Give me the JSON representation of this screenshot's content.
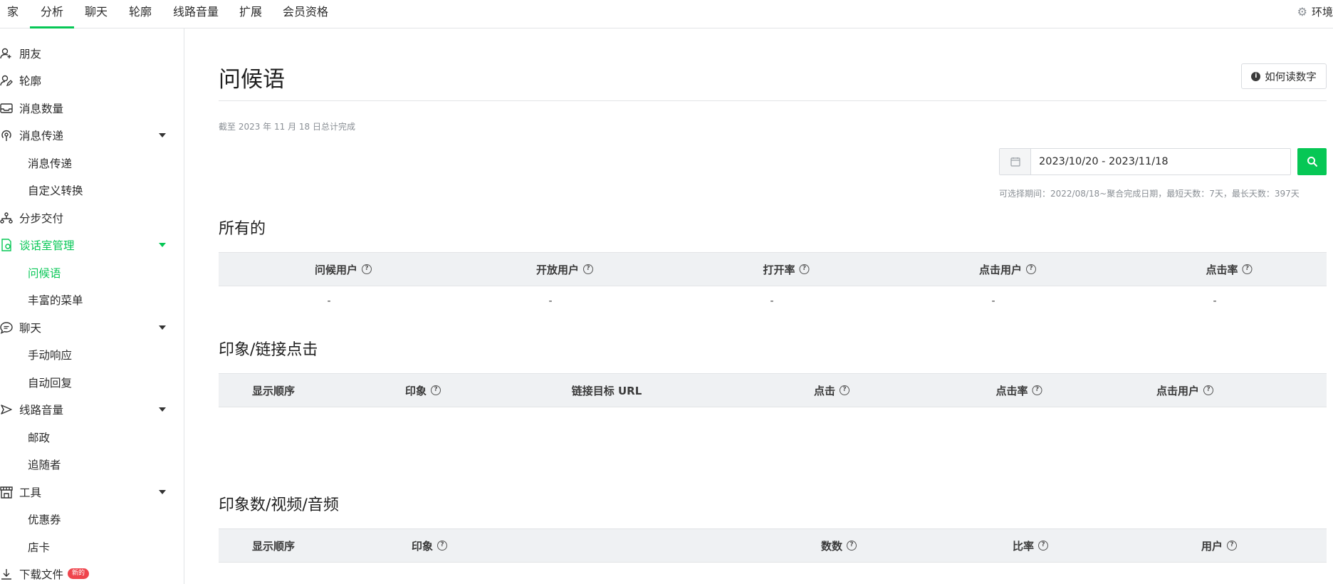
{
  "topnav": {
    "tabs": [
      "家",
      "分析",
      "聊天",
      "轮廓",
      "线路音量",
      "扩展",
      "会员资格"
    ],
    "active_index": 1,
    "right_label": "环境"
  },
  "sidebar": {
    "items": [
      {
        "label": "朋友",
        "icon": "add-friend-icon"
      },
      {
        "label": "轮廓",
        "icon": "profile-edit-icon"
      },
      {
        "label": "消息数量",
        "icon": "inbox-icon"
      },
      {
        "label": "消息传递",
        "icon": "broadcast-icon",
        "expanded": true
      },
      {
        "label": "消息传递",
        "sub": true
      },
      {
        "label": "自定义转换",
        "sub": true
      },
      {
        "label": "分步交付",
        "icon": "step-delivery-icon"
      },
      {
        "label": "谈话室管理",
        "icon": "chat-room-icon",
        "expanded": true,
        "active": true
      },
      {
        "label": "问候语",
        "sub": true,
        "active": true
      },
      {
        "label": "丰富的菜单",
        "sub": true
      },
      {
        "label": "聊天",
        "icon": "chat-bubble-icon",
        "expanded": true
      },
      {
        "label": "手动响应",
        "sub": true
      },
      {
        "label": "自动回复",
        "sub": true
      },
      {
        "label": "线路音量",
        "icon": "voom-icon",
        "expanded": true
      },
      {
        "label": "邮政",
        "sub": true
      },
      {
        "label": "追随者",
        "sub": true
      },
      {
        "label": "工具",
        "icon": "store-tools-icon",
        "expanded": true
      },
      {
        "label": "优惠券",
        "sub": true
      },
      {
        "label": "店卡",
        "sub": true
      },
      {
        "label": "下载文件",
        "icon": "download-icon",
        "badge": "新的"
      }
    ]
  },
  "main": {
    "title": "问候语",
    "help_button": "如何读数字",
    "note": "截至 2023 年 11 月 18 日总计完成",
    "date_range": "2023/10/20 - 2023/11/18",
    "date_hint": "可选择期间：2022/08/18~聚合完成日期，最短天数：7天，最长天数：397天",
    "sections": {
      "all": {
        "title": "所有的",
        "headers": [
          "问候用户",
          "开放用户",
          "打开率",
          "点击用户",
          "点击率"
        ],
        "values": [
          "-",
          "-",
          "-",
          "-",
          "-"
        ]
      },
      "links": {
        "title": "印象/链接点击",
        "headers": [
          "显示顺序",
          "印象",
          "链接目标 URL",
          "点击",
          "点击率",
          "点击用户"
        ]
      },
      "media": {
        "title": "印象数/视频/音频",
        "headers": [
          "显示顺序",
          "印象",
          "数数",
          "比率",
          "用户"
        ]
      }
    }
  },
  "colors": {
    "accent": "#06c755",
    "badge": "#ef454d",
    "table_header_bg": "#eff1f3",
    "muted_text": "#8a8f95"
  }
}
